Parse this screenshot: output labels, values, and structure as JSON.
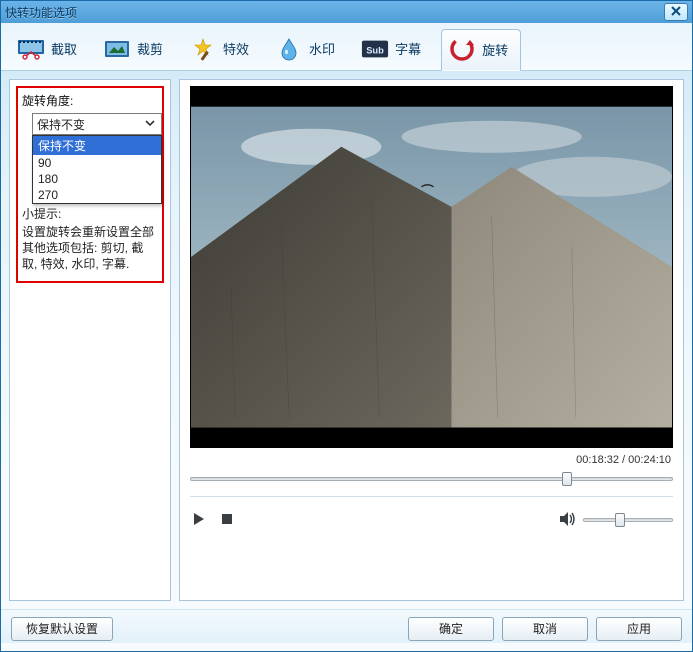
{
  "window": {
    "title": "快转功能选项"
  },
  "tabs": [
    {
      "id": "tab-capture",
      "label": "截取"
    },
    {
      "id": "tab-crop",
      "label": "裁剪"
    },
    {
      "id": "tab-effects",
      "label": "特效"
    },
    {
      "id": "tab-watermark",
      "label": "水印"
    },
    {
      "id": "tab-subtitle",
      "label": "字幕"
    },
    {
      "id": "tab-rotate",
      "label": "旋转",
      "active": true
    }
  ],
  "left": {
    "angle_label": "旋转角度:",
    "angle_value": "保持不变",
    "angle_options": [
      "保持不变",
      "90",
      "180",
      "270"
    ],
    "hint_title": "小提示:",
    "hint_body": "设置旋转会重新设置全部其他选项包括: 剪切, 截取, 特效, 水印, 字幕."
  },
  "player": {
    "current_time": "00:18:32",
    "duration": "00:24:10",
    "time_sep": " / ",
    "seek_percent": 77,
    "volume_percent": 36
  },
  "footer": {
    "restore": "恢复默认设置",
    "ok": "确定",
    "cancel": "取消",
    "apply": "应用"
  },
  "colors": {
    "highlight_border": "#e00000"
  }
}
